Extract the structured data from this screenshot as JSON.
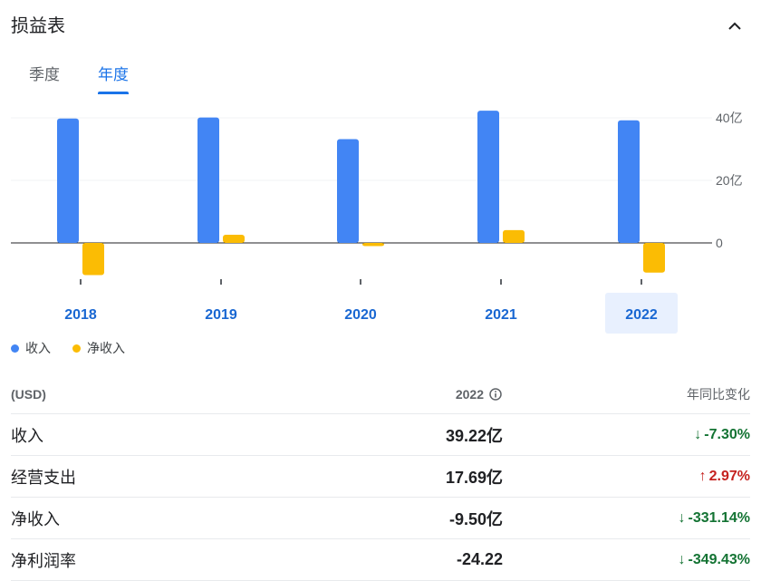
{
  "header": {
    "title": "损益表"
  },
  "tabs": [
    {
      "label": "季度",
      "active": false
    },
    {
      "label": "年度",
      "active": true
    }
  ],
  "chart_data": {
    "type": "bar",
    "categories": [
      "2018",
      "2019",
      "2020",
      "2021",
      "2022"
    ],
    "selected_category": "2022",
    "series": [
      {
        "name": "收入",
        "color": "#4285f4",
        "values": [
          39.8,
          40.1,
          33.2,
          42.3,
          39.22
        ]
      },
      {
        "name": "净收入",
        "color": "#fbbc04",
        "values": [
          -10.3,
          2.6,
          -1.0,
          4.1,
          -9.5
        ]
      }
    ],
    "y_ticks": [
      {
        "value": 40,
        "label": "40亿"
      },
      {
        "value": 20,
        "label": "20亿"
      },
      {
        "value": 0,
        "label": "0"
      }
    ],
    "ylim": [
      -12,
      45
    ],
    "grid": true,
    "legend_position": "bottom-left"
  },
  "legend": [
    {
      "label": "收入",
      "color": "#4285f4"
    },
    {
      "label": "净收入",
      "color": "#fbbc04"
    }
  ],
  "table": {
    "header": {
      "currency": "(USD)",
      "year": "2022",
      "change": "年同比变化"
    },
    "rows": [
      {
        "label": "收入",
        "value": "39.22亿",
        "change": "-7.30%",
        "direction": "down"
      },
      {
        "label": "经营支出",
        "value": "17.69亿",
        "change": "2.97%",
        "direction": "up"
      },
      {
        "label": "净收入",
        "value": "-9.50亿",
        "change": "-331.14%",
        "direction": "down"
      },
      {
        "label": "净利润率",
        "value": "-24.22",
        "change": "-349.43%",
        "direction": "down"
      }
    ]
  }
}
